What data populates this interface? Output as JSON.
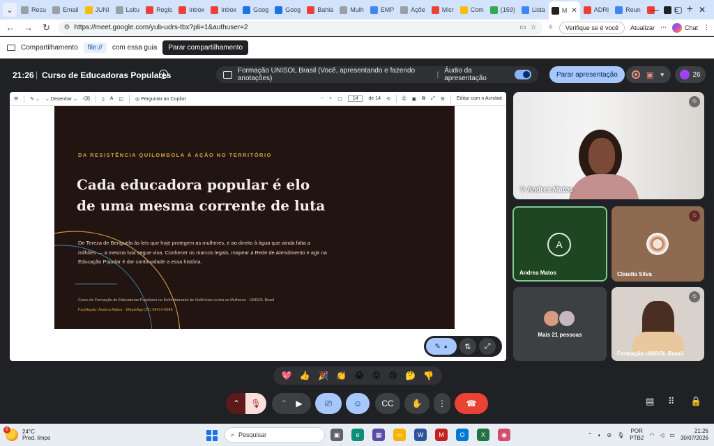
{
  "browser": {
    "tabs": [
      {
        "label": "Recu",
        "color": "#9aa0a6"
      },
      {
        "label": "Email",
        "color": "#9aa0a6"
      },
      {
        "label": "JUNI",
        "color": "#fbbc04"
      },
      {
        "label": "Leitu",
        "color": "#9aa0a6"
      },
      {
        "label": "Regis",
        "color": "#ea4335"
      },
      {
        "label": "Inbox",
        "color": "#ea4335"
      },
      {
        "label": "Inbox",
        "color": "#ea4335"
      },
      {
        "label": "Goog",
        "color": "#1a73e8"
      },
      {
        "label": "Goog",
        "color": "#1a73e8"
      },
      {
        "label": "Bahia",
        "color": "#ea4335"
      },
      {
        "label": "Mulh",
        "color": "#9aa0a6"
      },
      {
        "label": "EMP",
        "color": "#4285f4"
      },
      {
        "label": "Açõe",
        "color": "#9aa0a6"
      },
      {
        "label": "Micr",
        "color": "#ea4335"
      },
      {
        "label": "Com",
        "color": "#fbbc04"
      },
      {
        "label": "(159)",
        "color": "#34a853"
      },
      {
        "label": "Lista",
        "color": "#4285f4"
      },
      {
        "label": "M",
        "color": "#202124"
      },
      {
        "label": "ADRI",
        "color": "#ea4335"
      },
      {
        "label": "Reun",
        "color": "#4285f4"
      },
      {
        "label": "",
        "color": "#ea4335"
      },
      {
        "label": "E",
        "color": "#202124"
      }
    ],
    "new_tab": "+",
    "url": "https://meet.google.com/yub-udrs-tbx?pli=1&authuser=2",
    "verify_label": "Verifique se é você",
    "update_label": "Atualizar",
    "chat_label": "Chat"
  },
  "sharebar": {
    "prefix": "Compartilhamento",
    "chip": "file://",
    "suffix": "com essa guia",
    "stop_label": "Parar compartilhamento"
  },
  "meet": {
    "time": "21:26",
    "title": "Curso de Educadoras Populares",
    "presenting_text": "Formação UNISOL Brasil (Você, apresentando e fazendo anotações)",
    "audio_label": "Áudio da apresentação",
    "stop_present_label": "Parar apresentação",
    "participant_count": "26"
  },
  "pdf_toolbar": {
    "draw_label": "Desenhar",
    "copilot_label": "Perguntar ao Copilot",
    "page_current": "14",
    "page_total": "de 14",
    "edit_label": "Editar com o Acrobat"
  },
  "slide": {
    "eyebrow": "DA RESISTÊNCIA QUILOMBOLA À AÇÃO NO TERRITÓRIO",
    "title_line1": "Cada educadora popular é elo",
    "title_line2": "de uma mesma corrente de luta",
    "body_line1": "De Tereza de Benguela às leis que hoje protegem as mulheres, e ao direito à água que ainda falta a",
    "body_line2": "milhões — a mesma luta segue viva. Conhecer os marcos legais, mapear a Rede de Atendimento e agir na",
    "body_line3": "Educação Popular é dar continuidade a essa história.",
    "footer1": "Curso de Formação de Educadoras Populares no Enfrentamento às Violências contra as Mulheres · UNISOL Brasil",
    "footer2": "Facilitação: Andrea Matos · WhatsApp (21) 99414-0645"
  },
  "participants": {
    "main_name": "Andrea Matos",
    "andrea_initial": "A",
    "andrea_name": "Andrea Matos",
    "claudia_name": "Claudia Silva",
    "more_label": "Mais 21 pessoas",
    "formacao_name": "Formação UNISOL Brasil"
  },
  "reactions": [
    "💖",
    "👍",
    "🎉",
    "👏",
    "😂",
    "😮",
    "😢",
    "🤔",
    "👎"
  ],
  "taskbar": {
    "weather_badge": "6",
    "temp": "24°C",
    "weather_desc": "Pred. limpo",
    "search_label": "Pesquisar",
    "lang_line1": "POR",
    "lang_line2": "PTB2",
    "clock_time": "21:26",
    "clock_date": "30/07/2026"
  }
}
